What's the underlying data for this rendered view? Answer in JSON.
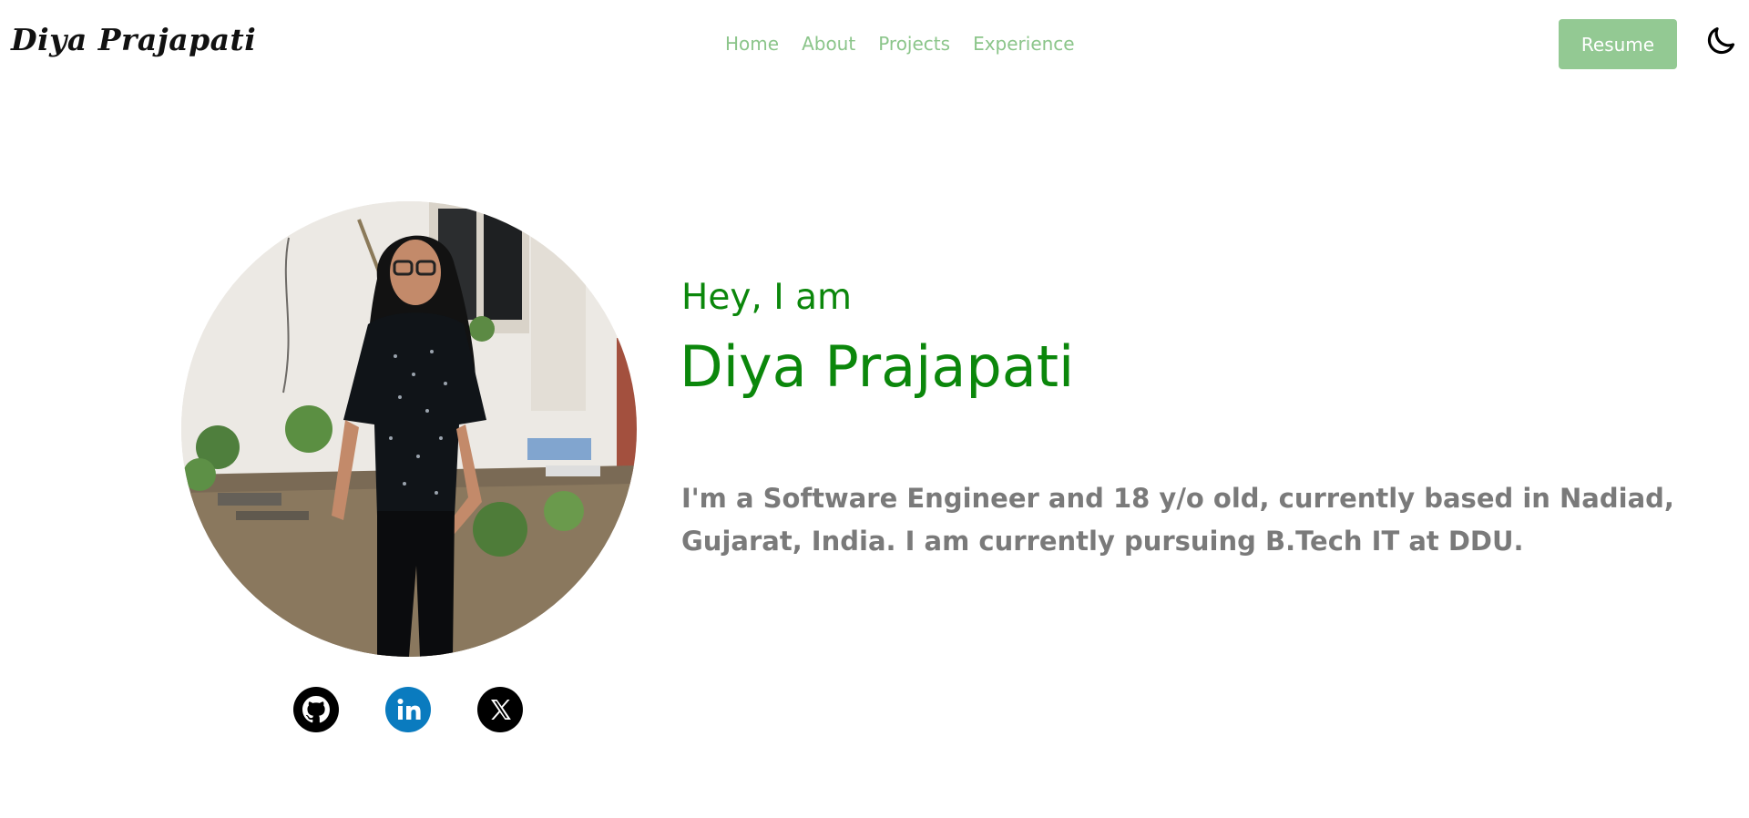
{
  "brand": {
    "logo_text": "Diya Prajapati"
  },
  "nav": {
    "links": [
      {
        "label": "Home"
      },
      {
        "label": "About"
      },
      {
        "label": "Projects"
      },
      {
        "label": "Experience"
      }
    ],
    "resume_label": "Resume",
    "theme_toggle_icon": "moon-icon"
  },
  "hero": {
    "greeting": "Hey, I am",
    "name": "Diya Prajapati",
    "bio": "I'm a Software Engineer and 18 y/o old, currently based in Nadiad, Gujarat, India. I am currently pursuing B.Tech IT at DDU.",
    "photo_icon": "profile-photo"
  },
  "socials": [
    {
      "icon": "github-icon"
    },
    {
      "icon": "linkedin-icon"
    },
    {
      "icon": "x-icon"
    }
  ],
  "colors": {
    "accent": "#0b870b",
    "nav_link": "#8bc58a",
    "button_bg": "#93c993",
    "bio_text": "#7a7a7a",
    "linkedin": "#0a7bbf"
  }
}
